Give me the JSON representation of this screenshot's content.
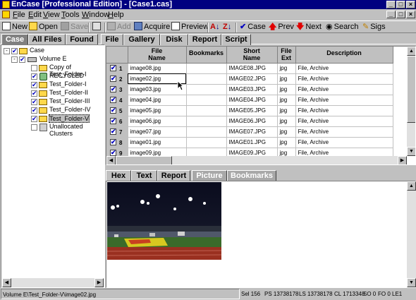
{
  "window": {
    "title": "EnCase [Professional Edition] - [Case1.cas]"
  },
  "menu": [
    {
      "label": "File",
      "u": "F",
      "rest": "ile"
    },
    {
      "label": "Edit",
      "u": "E",
      "rest": "dit"
    },
    {
      "label": "View",
      "u": "V",
      "rest": "iew"
    },
    {
      "label": "Tools",
      "u": "T",
      "rest": "ools"
    },
    {
      "label": "Window",
      "u": "W",
      "rest": "indow"
    },
    {
      "label": "Help",
      "u": "H",
      "rest": "elp"
    }
  ],
  "toolbar": {
    "new": "New",
    "open": "Open",
    "save": "Save",
    "add": "Add",
    "acquire": "Acquire",
    "preview": "Preview",
    "case": "Case",
    "prev": "Prev",
    "next": "Next",
    "search": "Search",
    "sigs": "Sigs"
  },
  "main_tabs": [
    "Case",
    "All Files",
    "Found",
    "File",
    "Gallery",
    "Disk",
    "Report",
    "Script"
  ],
  "tree": [
    {
      "label": "Case",
      "checked": true
    },
    {
      "label": "Volume E",
      "checked": true
    },
    {
      "label": "Copy of Test_Folder-I",
      "checked": false
    },
    {
      "label": "RECYCLED",
      "checked": true
    },
    {
      "label": "Test_Folder-I",
      "checked": true
    },
    {
      "label": "Test_Folder-II",
      "checked": true
    },
    {
      "label": "Test_Folder-III",
      "checked": true
    },
    {
      "label": "Test_Folder-IV",
      "checked": true
    },
    {
      "label": "Test_Folder-V",
      "checked": true
    },
    {
      "label": "Unallocated Clusters",
      "checked": false
    }
  ],
  "table": {
    "headers": [
      {
        "l1": "File",
        "l2": "Name"
      },
      {
        "l1": "Bookmarks",
        "l2": ""
      },
      {
        "l1": "Short",
        "l2": "Name"
      },
      {
        "l1": "File",
        "l2": "Ext"
      },
      {
        "l1": "Description",
        "l2": ""
      }
    ],
    "rows": [
      {
        "n": "1",
        "name": "image08.jpg",
        "bm": "",
        "short": "IMAGE08.JPG",
        "ext": "jpg",
        "desc": "File, Archive"
      },
      {
        "n": "2",
        "name": "image02.jpg",
        "bm": "",
        "short": "IMAGE02.JPG",
        "ext": "jpg",
        "desc": "File, Archive"
      },
      {
        "n": "3",
        "name": "image03.jpg",
        "bm": "",
        "short": "IMAGE03.JPG",
        "ext": "jpg",
        "desc": "File, Archive"
      },
      {
        "n": "4",
        "name": "image04.jpg",
        "bm": "",
        "short": "IMAGE04.JPG",
        "ext": "jpg",
        "desc": "File, Archive"
      },
      {
        "n": "5",
        "name": "image05.jpg",
        "bm": "",
        "short": "IMAGE05.JPG",
        "ext": "jpg",
        "desc": "File, Archive"
      },
      {
        "n": "6",
        "name": "image06.jpg",
        "bm": "",
        "short": "IMAGE06.JPG",
        "ext": "jpg",
        "desc": "File, Archive"
      },
      {
        "n": "7",
        "name": "image07.jpg",
        "bm": "",
        "short": "IMAGE07.JPG",
        "ext": "jpg",
        "desc": "File, Archive"
      },
      {
        "n": "8",
        "name": "image01.jpg",
        "bm": "",
        "short": "IMAGE01.JPG",
        "ext": "jpg",
        "desc": "File, Archive"
      },
      {
        "n": "9",
        "name": "image09.jpg",
        "bm": "",
        "short": "IMAGE09.JPG",
        "ext": "jpg",
        "desc": "File, Archive"
      }
    ]
  },
  "view_tabs": [
    "Hex",
    "Text",
    "Report",
    "Picture",
    "Bookmarks"
  ],
  "status": {
    "path": "Volume E\\Test_Folder-V\\image02.jpg",
    "sel": "Sel 156",
    "ps": "PS 13738178",
    "ls": "LS 13738178",
    "cl": "CL 1713348",
    "so": "SO 0",
    "fo": "FO 0",
    "le": "LE1"
  }
}
